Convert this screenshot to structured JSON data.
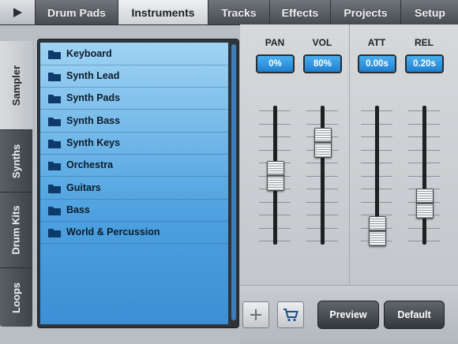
{
  "topbar": {
    "play_icon": "play-icon",
    "tabs": [
      {
        "label": "Drum Pads"
      },
      {
        "label": "Instruments",
        "active": true
      },
      {
        "label": "Tracks"
      },
      {
        "label": "Effects"
      },
      {
        "label": "Projects"
      },
      {
        "label": "Setup"
      }
    ]
  },
  "sidebar": {
    "tabs": [
      {
        "label": "Sampler",
        "active": true
      },
      {
        "label": "Synths"
      },
      {
        "label": "Drum Kits"
      },
      {
        "label": "Loops"
      }
    ]
  },
  "instruments": {
    "folder_icon": "folder-icon",
    "items": [
      {
        "label": "Keyboard"
      },
      {
        "label": "Synth Lead"
      },
      {
        "label": "Synth Pads"
      },
      {
        "label": "Synth Bass"
      },
      {
        "label": "Synth Keys"
      },
      {
        "label": "Orchestra"
      },
      {
        "label": "Guitars"
      },
      {
        "label": "Bass"
      },
      {
        "label": "World & Percussion"
      }
    ]
  },
  "mixer": {
    "channels": [
      {
        "label": "PAN",
        "value": "0%",
        "level": 0.5
      },
      {
        "label": "VOL",
        "value": "80%",
        "level": 0.8
      },
      {
        "label": "ATT",
        "value": "0.00s",
        "level": 0.0
      },
      {
        "label": "REL",
        "value": "0.20s",
        "level": 0.25
      }
    ]
  },
  "buttons": {
    "add_icon": "plus-icon",
    "cart_icon": "cart-icon",
    "preview": "Preview",
    "default": "Default"
  },
  "colors": {
    "accent": "#2a8fe0",
    "list_top": "#9fd3f3",
    "list_bottom": "#3b8fd4"
  }
}
